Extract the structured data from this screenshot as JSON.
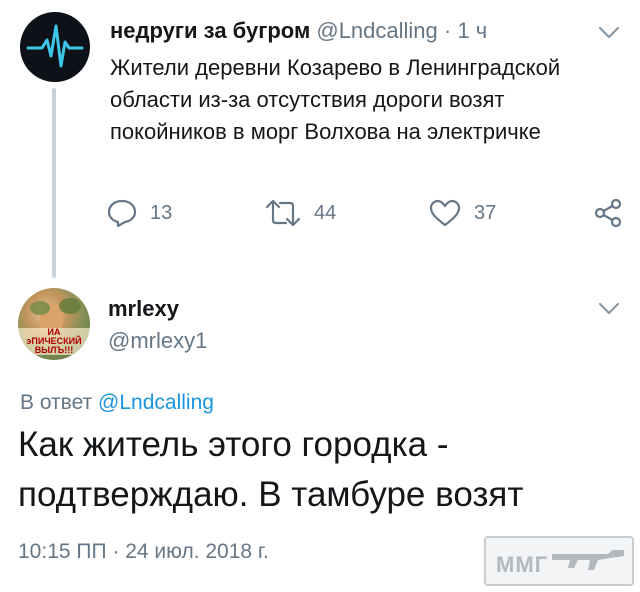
{
  "thread_tweet": {
    "display_name": "недруги за бугром",
    "handle": "@Lndcalling",
    "separator": "·",
    "time_ago": "1 ч",
    "text": "Жители деревни Козарево в Ленинградской области из-за отсутствия дороги возят покойников в морг Волхова на электричке",
    "replies": "13",
    "retweets": "44",
    "likes": "37",
    "avatar_icon": "heartbeat-pulse-icon"
  },
  "main_tweet": {
    "display_name": "mrlexy",
    "handle": "@mrlexy1",
    "reply_prefix": "В ответ",
    "reply_to": "@Lndcalling",
    "text": "Как житель этого городка - подтверждаю. В тамбуре возят",
    "timestamp": "10:15 ПП · 24 июл. 2018 г.",
    "avatar_lines": [
      "ИА",
      "эПИЧЕСКИЙ",
      "ВЫЛЪ!!!"
    ]
  },
  "watermark": {
    "text": "ММГ",
    "icon": "rifle-icon"
  },
  "colors": {
    "text_primary": "#14171a",
    "text_secondary": "#657786",
    "link": "#1b95e0",
    "thread_line": "#c9d1d9"
  }
}
